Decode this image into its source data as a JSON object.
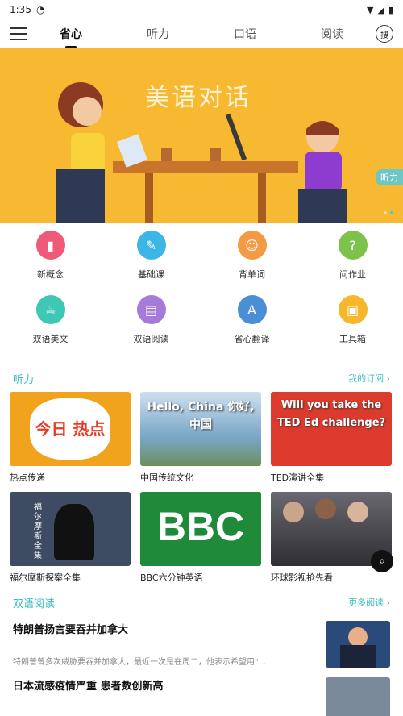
{
  "status": {
    "time": "1:35"
  },
  "nav": {
    "tabs": [
      "省心",
      "听力",
      "口语",
      "阅读"
    ],
    "search_label": "搜"
  },
  "banner": {
    "title": "美语对话",
    "tag": "听力"
  },
  "grid": [
    {
      "label": "新概念",
      "icon": "book-icon",
      "color": "#ef5a78"
    },
    {
      "label": "基础课",
      "icon": "brush-icon",
      "color": "#3bb6e6"
    },
    {
      "label": "背单词",
      "icon": "head-icon",
      "color": "#f49a44"
    },
    {
      "label": "问作业",
      "icon": "question-cloud-icon",
      "color": "#7dc24b"
    },
    {
      "label": "双语美文",
      "icon": "cup-icon",
      "color": "#3ec7b4"
    },
    {
      "label": "双语阅读",
      "icon": "reader-icon",
      "color": "#a57ad8"
    },
    {
      "label": "省心翻译",
      "icon": "translate-icon",
      "color": "#4a8ed6"
    },
    {
      "label": "工具箱",
      "icon": "toolbox-icon",
      "color": "#f5b72c"
    }
  ],
  "listening": {
    "title": "听力",
    "more": "我的订阅 ›",
    "cards": [
      {
        "title": "热点传递",
        "thumb_text": "今日 热点",
        "color": "#f2a31e"
      },
      {
        "title": "中国传统文化",
        "thumb_text": "Hello, China 你好,中国",
        "color": "#7aa7c9"
      },
      {
        "title": "TED演讲全集",
        "thumb_text": "Will you take the TED Ed challenge?",
        "color": "#dc3a2c"
      },
      {
        "title": "福尔摩斯探案全集",
        "thumb_text": "福尔摩斯全集",
        "color": "#3d4c63"
      },
      {
        "title": "BBC六分钟英语",
        "thumb_text": "BBC",
        "color": "#1e8a3a"
      },
      {
        "title": "环球影视抢先看",
        "thumb_text": "",
        "color": "#4b4a50"
      }
    ]
  },
  "reading": {
    "title": "双语阅读",
    "more": "更多阅读 ›",
    "articles": [
      {
        "title": "特朗普扬言要吞并加拿大",
        "desc": "特朗普曾多次威胁要吞并加拿大，最近一次是在周二，他表示希望用\"..."
      },
      {
        "title": "日本流感疫情严重 患者数创新高",
        "desc": ""
      }
    ]
  }
}
